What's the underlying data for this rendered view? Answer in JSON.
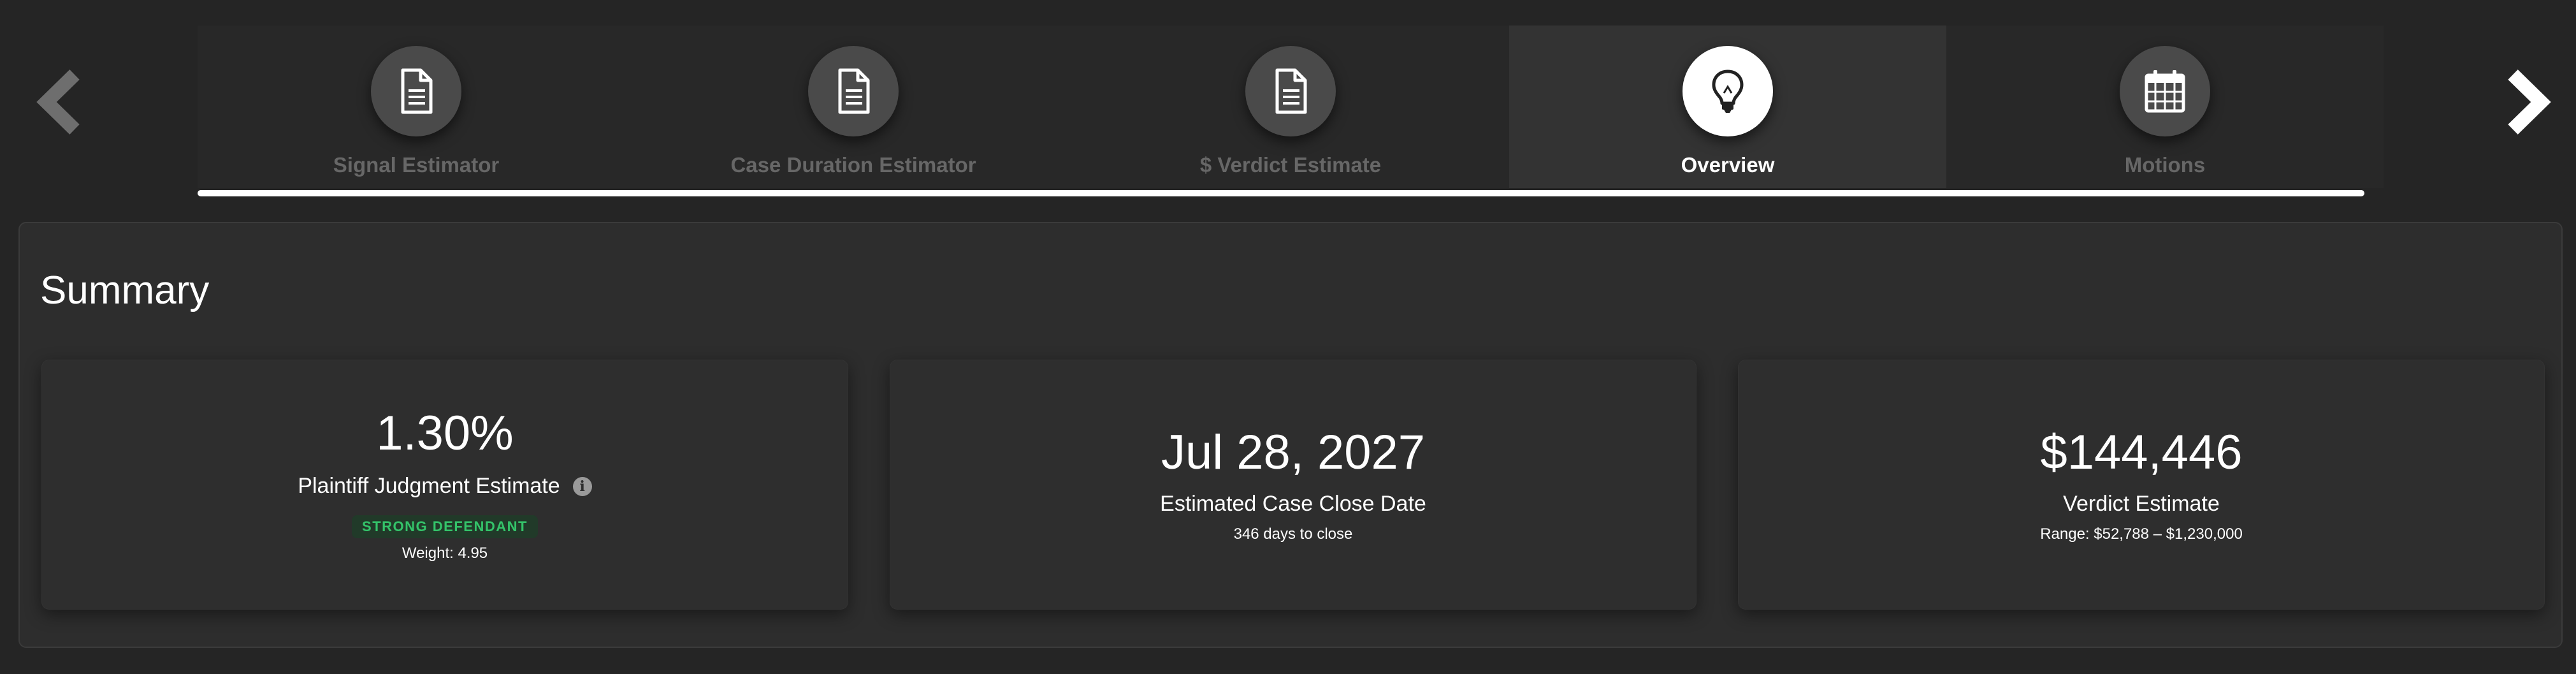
{
  "nav": {
    "prev_icon": "chevron-left-icon",
    "next_icon": "chevron-right-icon"
  },
  "tabs": [
    {
      "label": "Signal Estimator",
      "icon": "document-icon",
      "active": false
    },
    {
      "label": "Case Duration Estimator",
      "icon": "document-icon",
      "active": false
    },
    {
      "label": "$ Verdict Estimate",
      "icon": "document-icon",
      "active": false
    },
    {
      "label": "Overview",
      "icon": "lightbulb-icon",
      "active": true
    },
    {
      "label": "Motions",
      "icon": "calendar-icon",
      "active": false
    }
  ],
  "summary": {
    "title": "Summary",
    "cards": [
      {
        "value": "1.30%",
        "label": "Plaintiff Judgment Estimate",
        "info_icon": "i",
        "badge": "STRONG DEFENDANT",
        "sub": "Weight: 4.95"
      },
      {
        "value": "Jul 28, 2027",
        "label": "Estimated Case Close Date",
        "sub": "346 days to close"
      },
      {
        "value": "$144,446",
        "label": "Verdict Estimate",
        "sub": "Range: $52,788 – $1,230,000"
      }
    ]
  },
  "colors": {
    "background": "#252525",
    "panel": "#2d2d2d",
    "inactive_tab_text": "#676767",
    "badge_text": "#34c46a",
    "badge_bg": "#213a29"
  }
}
